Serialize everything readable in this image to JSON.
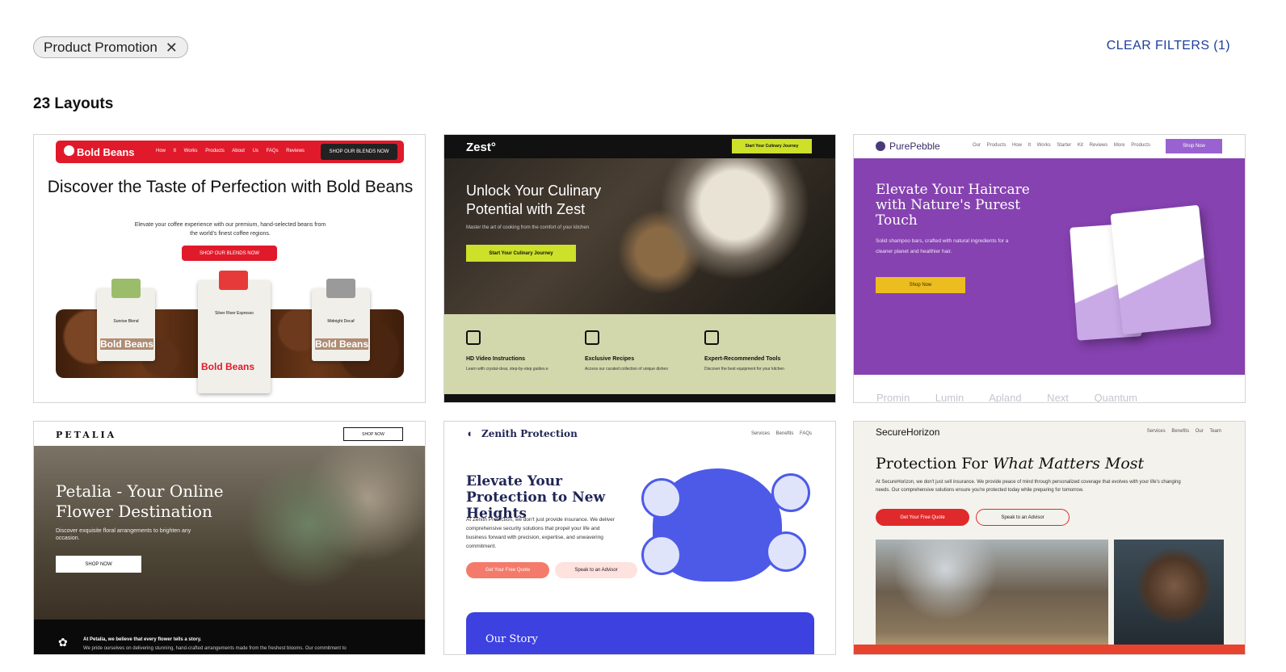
{
  "filters": {
    "chip_label": "Product Promotion",
    "chip_remove_icon": "close-icon",
    "clear_label": "CLEAR FILTERS (1)"
  },
  "results": {
    "count_label": "23 Layouts"
  },
  "cards": {
    "bold_beans": {
      "logo": "Bold Beans",
      "nav": "How It Works Products About Us FAQs Reviews",
      "nav_cta": "SHOP OUR BLENDS NOW",
      "headline": "Discover the Taste of Perfection with Bold Beans",
      "sub": "Elevate your coffee experience with our premium, hand-selected beans from the world's finest coffee regions.",
      "cta": "SHOP OUR BLENDS NOW",
      "bag1": "Sunrise Blend",
      "bag2": "Silver River Espresso",
      "bag3": "Midnight Decaf",
      "bag_brand": "Bold Beans"
    },
    "zest": {
      "logo": "Zest°",
      "nav_cta": "Start Your Culinary Journey",
      "headline": "Unlock Your Culinary Potential with Zest",
      "sub": "Master the art of cooking from the comfort of your kitchen",
      "cta": "Start Your Culinary Journey",
      "f1_title": "HD Video Instructions",
      "f1_desc": "Learn with crystal-clear, step-by-step guides.e",
      "f2_title": "Exclusive Recipes",
      "f2_desc": "Access our curated collection of unique dishes",
      "f3_title": "Expert-Recommended Tools",
      "f3_desc": "Discover the best equipment for your kitchen"
    },
    "pure_pebble": {
      "logo": "PurePebble",
      "nav": "Our Products How It Works Starter Kit Reviews More Products",
      "nav_cta": "Shop Now",
      "headline": "Elevate Your Haircare with Nature's Purest Touch",
      "sub": "Solid shampoo bars, crafted with natural ingredients for a cleaner planet and healthier hair.",
      "cta": "Shop Now",
      "logos": "Promin Lumin Apland Next Quantum"
    },
    "petalia": {
      "logo": "PETALIA",
      "nav_cta": "SHOP NOW",
      "headline": "Petalia - Your Online Flower Destination",
      "sub": "Discover exquisite floral arrangements to brighten any occasion.",
      "cta": "SHOP NOW",
      "foot1": "At Petalia, we believe that every flower tells a story.",
      "foot2": "We pride ourselves on delivering stunning, hand-crafted arrangements made from the freshest blooms. Our commitment to"
    },
    "zenith": {
      "logo": "Zenith Protection",
      "nav": "Services Benefits FAQs",
      "headline": "Elevate Your Protection to New Heights",
      "sub": "At Zenith Protection, we don't just provide insurance. We deliver comprehensive security solutions that propel your life and business forward with precision, expertise, and unwavering commitment.",
      "cta1": "Get Your Free Quote",
      "cta2": "Speak to an Advisor",
      "story": "Our Story"
    },
    "secure_horizon": {
      "logo": "SecureHorizon",
      "nav": "Services Benefits Our Team",
      "headline_plain": "Protection For ",
      "headline_italic": "What Matters Most",
      "sub": "At SecureHorizon, we don't just sell insurance. We provide peace of mind through personalized coverage that evolves with your life's changing needs. Our comprehensive solutions ensure you're protected today while preparing for tomorrow.",
      "cta1": "Get Your Free Quote",
      "cta2": "Speak to an Advisor"
    }
  }
}
